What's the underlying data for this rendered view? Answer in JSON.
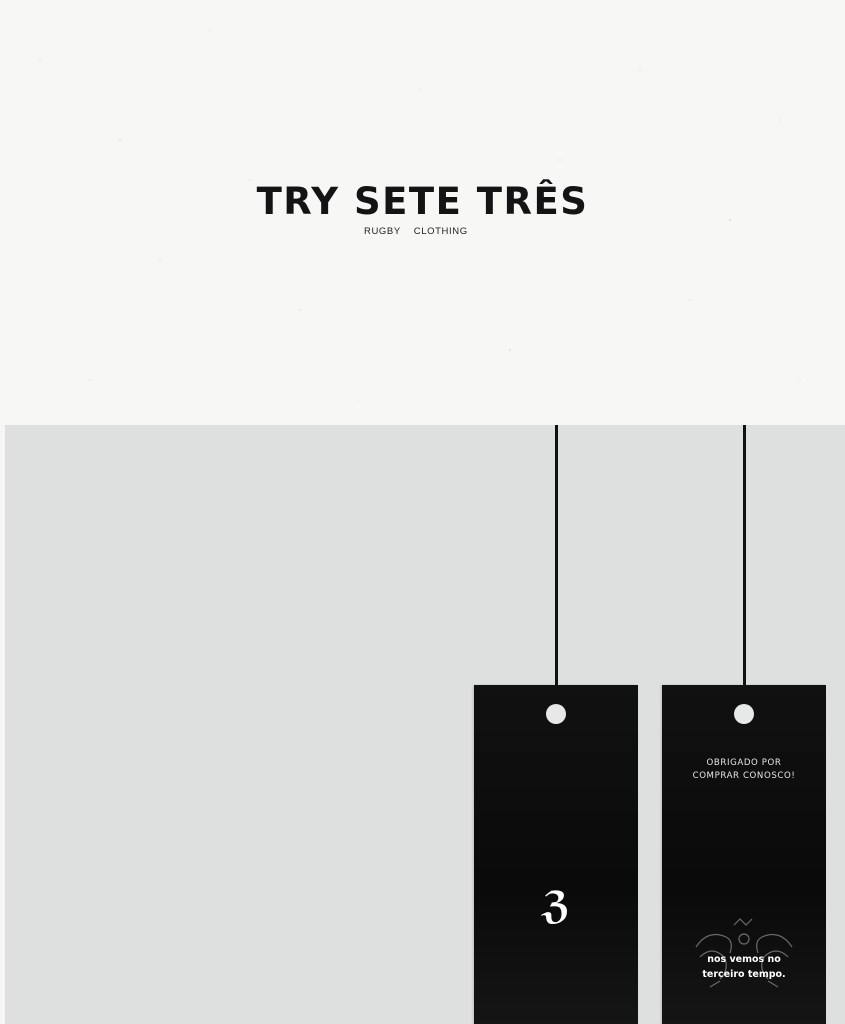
{
  "brand": {
    "name": "TRY SETE TRÊS",
    "tagline_left": "RUGBY",
    "tagline_right": "CLOTHING"
  },
  "tags": {
    "front": {
      "monogram": "ℨ"
    },
    "back": {
      "message_line1": "OBRIGADO POR",
      "message_line2": "COMPRAR CONOSCO!",
      "footer_line1": "nos vemos no",
      "footer_line2": "terceiro tempo."
    }
  },
  "colors": {
    "top_background": "#f7f7f6",
    "bottom_background": "#dde0de",
    "tag": "#111111",
    "text_dark": "#141414"
  },
  "icons": {
    "front_tag_logo": "monogram-icon",
    "back_tag_art": "hands-illustration-icon"
  }
}
